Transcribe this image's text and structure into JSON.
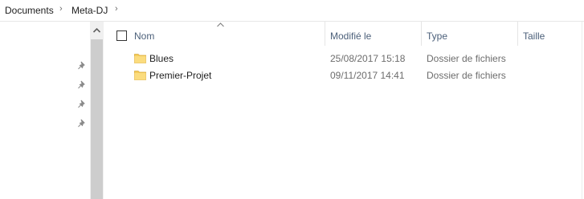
{
  "breadcrumb": {
    "items": [
      "Documents",
      "Meta-DJ"
    ]
  },
  "columns": {
    "name": "Nom",
    "modified": "Modifié le",
    "type": "Type",
    "size": "Taille",
    "sorted_by": "name",
    "sort_direction": "ascending"
  },
  "rows": [
    {
      "name": "Blues",
      "modified": "25/08/2017 15:18",
      "type": "Dossier de fichiers",
      "size": ""
    },
    {
      "name": "Premier-Projet",
      "modified": "09/11/2017 14:41",
      "type": "Dossier de fichiers",
      "size": ""
    }
  ],
  "quick_access_pins": [
    "pin-icon",
    "pin-icon",
    "pin-icon",
    "pin-icon"
  ],
  "colors": {
    "folder": "#f5cd5c",
    "header_text": "#4c607a",
    "scroll_thumb": "#cdcdcd"
  }
}
